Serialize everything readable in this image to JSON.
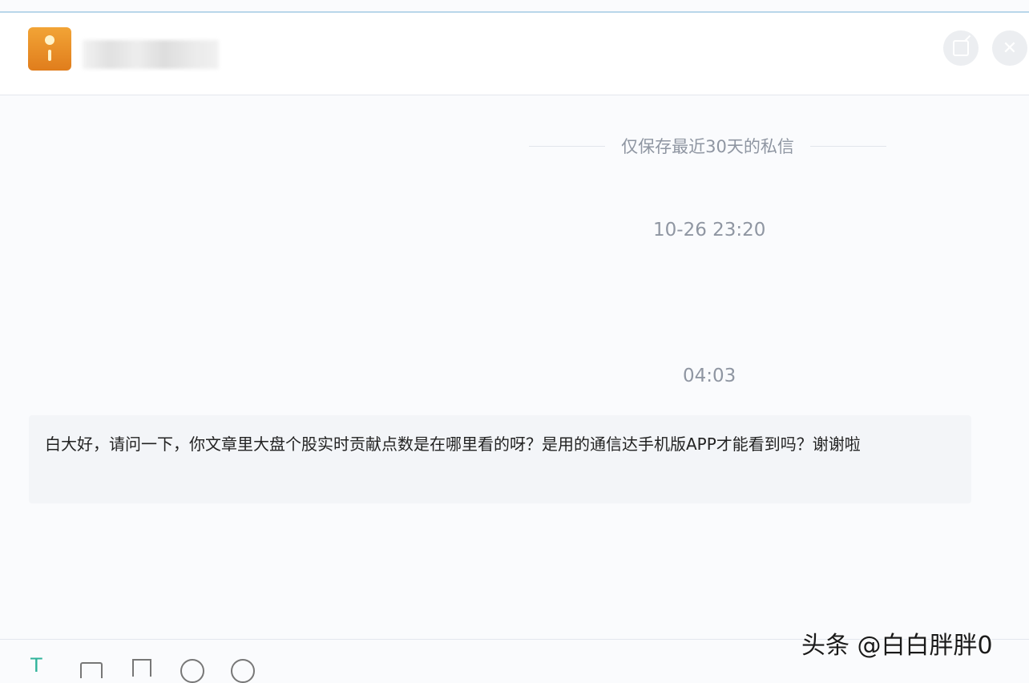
{
  "header": {
    "avatar_icon": "app-avatar-icon",
    "contact_name": "",
    "edit_icon": "edit-icon",
    "close_icon": "close-icon",
    "close_glyph": "✕"
  },
  "conversation": {
    "retention_notice": "仅保存最近30天的私信",
    "timestamps": [
      "10-26 23:20",
      "04:03"
    ],
    "messages": [
      {
        "text": "白大好，请问一下，你文章里大盘个股实时贡献点数是在哪里看的呀？是用的通信达手机版APP才能看到吗？谢谢啦"
      }
    ]
  },
  "toolbar": {
    "text_format_glyph": "T",
    "icons": [
      "text-format-icon",
      "image-icon",
      "file-icon",
      "emoji-icon",
      "video-icon"
    ]
  },
  "watermark": "头条 @白白胖胖0",
  "colors": {
    "accent_teal": "#2fb39a",
    "avatar_orange": "#e98e28",
    "muted_text": "#8f96a2"
  }
}
